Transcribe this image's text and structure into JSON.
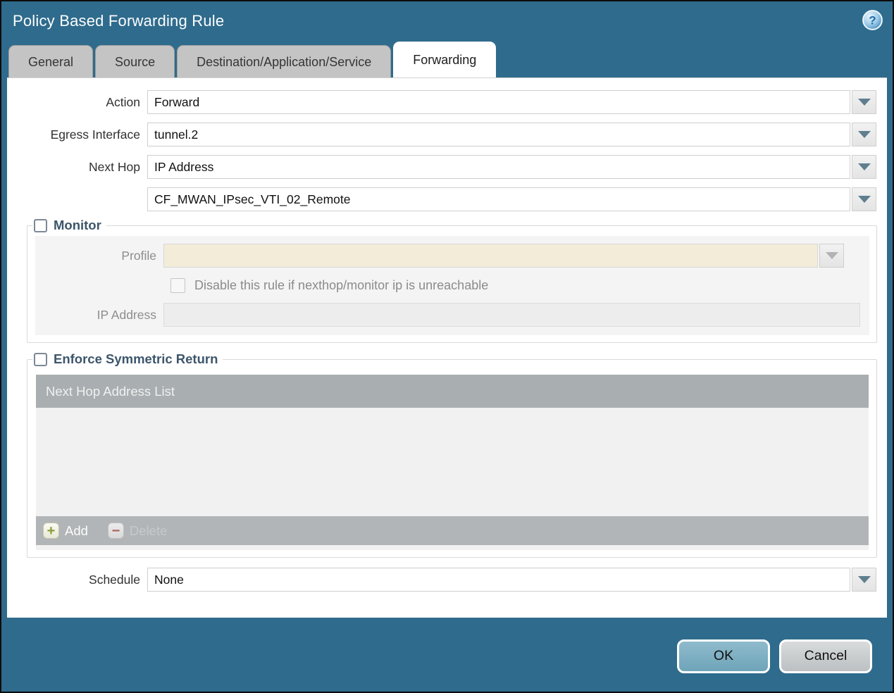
{
  "window": {
    "title": "Policy Based Forwarding Rule"
  },
  "tabs": [
    {
      "label": "General",
      "active": false
    },
    {
      "label": "Source",
      "active": false
    },
    {
      "label": "Destination/Application/Service",
      "active": false
    },
    {
      "label": "Forwarding",
      "active": true
    }
  ],
  "form": {
    "action": {
      "label": "Action",
      "value": "Forward"
    },
    "egress_interface": {
      "label": "Egress Interface",
      "value": "tunnel.2"
    },
    "next_hop": {
      "label": "Next Hop",
      "value": "IP Address"
    },
    "next_hop_address": {
      "value": "CF_MWAN_IPsec_VTI_02_Remote"
    },
    "schedule": {
      "label": "Schedule",
      "value": "None"
    }
  },
  "monitor": {
    "legend": "Monitor",
    "checked": false,
    "profile": {
      "label": "Profile",
      "value": ""
    },
    "disable_rule": {
      "label": "Disable this rule if nexthop/monitor ip is unreachable",
      "checked": false
    },
    "ip_address": {
      "label": "IP Address",
      "value": ""
    }
  },
  "symmetric_return": {
    "legend": "Enforce Symmetric Return",
    "checked": false,
    "table": {
      "header": "Next Hop Address List",
      "rows": []
    },
    "add_label": "Add",
    "delete_label": "Delete"
  },
  "footer": {
    "ok_label": "OK",
    "cancel_label": "Cancel"
  },
  "icons": {
    "help": "help-icon",
    "add": "plus-icon",
    "delete": "minus-icon",
    "dropdown": "chevron-down-icon"
  },
  "colors": {
    "titlebar": "#2f6b8c",
    "tab_inactive": "#c4c4c4",
    "tab_active": "#ffffff",
    "disabled_field_beige": "#f2ecd9",
    "table_header": "#a9aeb0",
    "table_footer": "#b1b5b7",
    "ok_button": "#7fb0c3",
    "cancel_button": "#c9cccd",
    "legend_text": "#3d566b"
  }
}
